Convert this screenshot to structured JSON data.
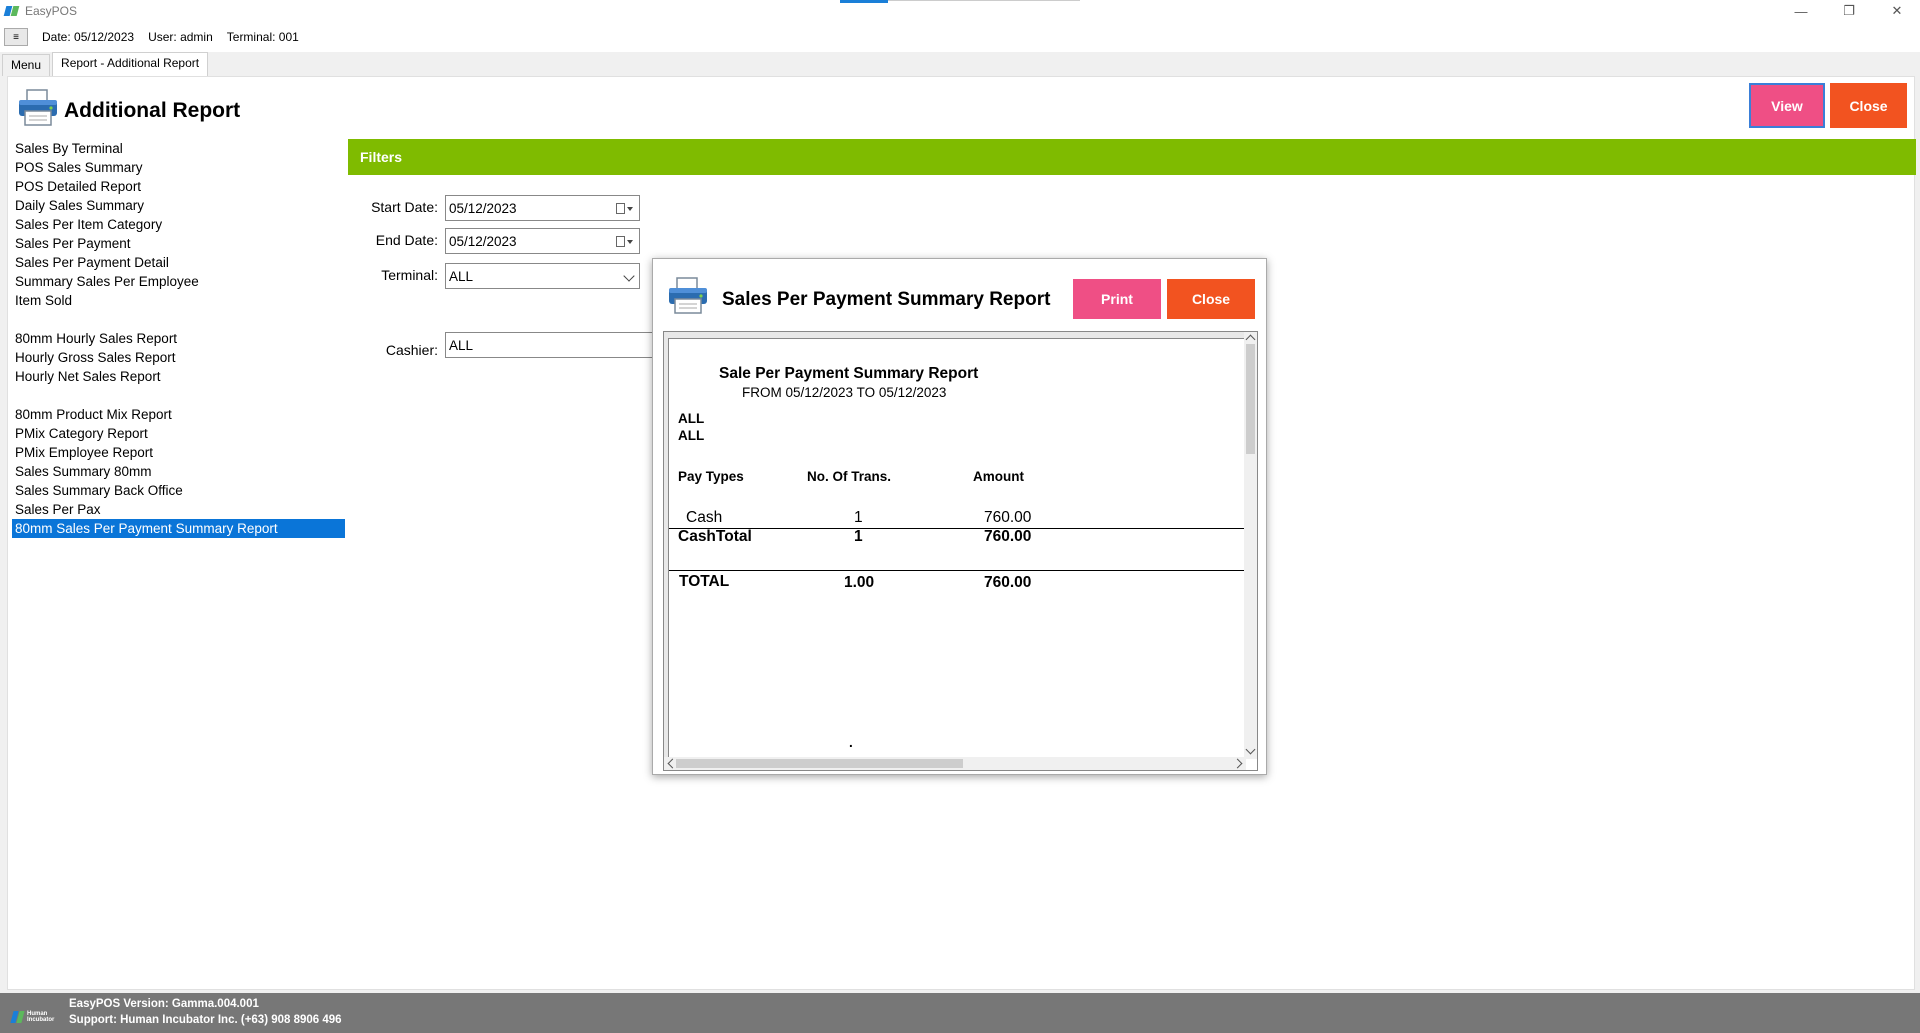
{
  "window": {
    "title": "EasyPOS",
    "minimize": "—",
    "maximize": "❐",
    "close": "✕"
  },
  "infobar": {
    "menu_icon": "≡",
    "date": "Date: 05/12/2023",
    "user": "User: admin",
    "terminal": "Terminal: 001"
  },
  "tabs": [
    {
      "label": "Menu"
    },
    {
      "label": "Report - Additional Report"
    }
  ],
  "header": {
    "title": "Additional Report",
    "icon": "printer-icon",
    "view_label": "View",
    "close_label": "Close",
    "view_color": "#ef4f85",
    "close_color": "#f25320"
  },
  "reports": {
    "group1": [
      "Sales By Terminal",
      "POS Sales Summary",
      "POS Detailed Report",
      "Daily Sales Summary",
      "Sales Per Item Category",
      "Sales Per Payment",
      "Sales Per Payment Detail",
      "Summary Sales Per Employee",
      "Item Sold"
    ],
    "group2": [
      "80mm Hourly Sales Report",
      "Hourly Gross Sales Report",
      "Hourly Net Sales Report"
    ],
    "group3": [
      "80mm Product Mix Report",
      "PMix Category Report",
      "PMix Employee Report",
      "Sales Summary 80mm",
      "Sales Summary Back Office",
      "Sales Per Pax"
    ],
    "selected": "80mm Sales Per Payment Summary Report"
  },
  "filters": {
    "title": "Filters",
    "bar_color": "#7fbb00",
    "start_date_label": "Start Date:",
    "start_date_value": "05/12/2023",
    "end_date_label": "End Date:",
    "end_date_value": "05/12/2023",
    "terminal_label": "Terminal:",
    "terminal_value": "ALL",
    "cashier_label": "Cashier:",
    "cashier_value": "ALL"
  },
  "dialog": {
    "title": "Sales Per Payment Summary Report",
    "print_label": "Print",
    "close_label": "Close",
    "report": {
      "title": "Sale Per Payment Summary Report",
      "range": "FROM 05/12/2023 TO 05/12/2023",
      "filter1": "ALL",
      "filter2": "ALL",
      "col_pay_types": "Pay Types",
      "col_trans": "No. Of Trans.",
      "col_amount": "Amount",
      "row_type": "Cash",
      "row_trans": "1",
      "row_amount": "760.00",
      "subtotal_label": "CashTotal",
      "subtotal_trans": "1",
      "subtotal_amount": "760.00",
      "total_label": "TOTAL",
      "total_trans": "1.00",
      "total_amount": "760.00",
      "dot": "."
    }
  },
  "footer": {
    "logo_text_1": "Human",
    "logo_text_2": "Incubator",
    "version": "EasyPOS Version: Gamma.004.001",
    "support": "Support: Human Incubator Inc. (+63) 908 8906 496"
  }
}
